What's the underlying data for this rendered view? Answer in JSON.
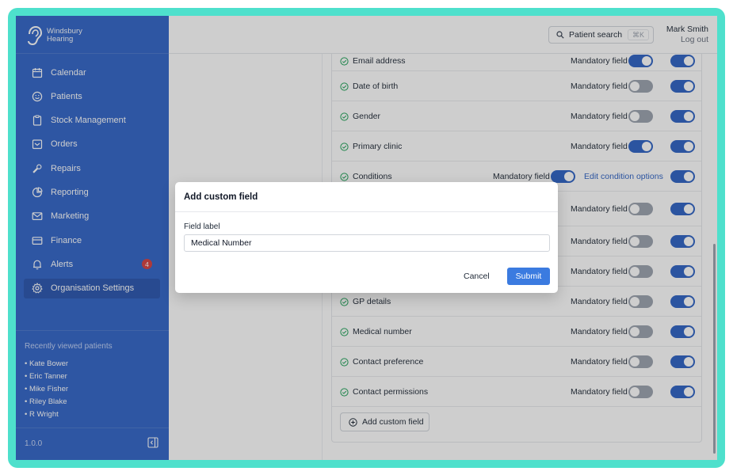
{
  "brand": {
    "line1": "Windsbury",
    "line2": "Hearing"
  },
  "nav": [
    {
      "label": "Calendar",
      "icon": "calendar-icon"
    },
    {
      "label": "Patients",
      "icon": "smiley-icon"
    },
    {
      "label": "Stock Management",
      "icon": "clipboard-icon"
    },
    {
      "label": "Orders",
      "icon": "inbox-icon"
    },
    {
      "label": "Repairs",
      "icon": "wrench-icon"
    },
    {
      "label": "Reporting",
      "icon": "pie-chart-icon"
    },
    {
      "label": "Marketing",
      "icon": "mail-icon"
    },
    {
      "label": "Finance",
      "icon": "credit-card-icon"
    },
    {
      "label": "Alerts",
      "icon": "bell-icon",
      "badge": "4"
    },
    {
      "label": "Organisation Settings",
      "icon": "gear-icon",
      "active": true
    }
  ],
  "recent": {
    "title": "Recently viewed patients",
    "items": [
      "• Kate Bower",
      "• Eric Tanner",
      "• Mike Fisher",
      "• Riley Blake",
      "• R Wright"
    ]
  },
  "version": "1.0.0",
  "topbar": {
    "search_label": "Patient search",
    "shortcut": "⌘K",
    "user_name": "Mark Smith",
    "logout": "Log out"
  },
  "fields": [
    {
      "label": "Email address",
      "mandatory": "Mandatory field",
      "mandatory_on": true,
      "enabled": true
    },
    {
      "label": "Date of birth",
      "mandatory": "Mandatory field",
      "mandatory_on": false,
      "enabled": true
    },
    {
      "label": "Gender",
      "mandatory": "Mandatory field",
      "mandatory_on": false,
      "enabled": true
    },
    {
      "label": "Primary clinic",
      "mandatory": "Mandatory field",
      "mandatory_on": true,
      "enabled": true
    },
    {
      "label": "Conditions",
      "mandatory": "Mandatory field",
      "mandatory_on": true,
      "enabled": true,
      "edit": "Edit condition options"
    },
    {
      "label": "",
      "mandatory": "Mandatory field",
      "mandatory_on": false,
      "enabled": true
    },
    {
      "label": "",
      "mandatory": "Mandatory field",
      "mandatory_on": false,
      "enabled": true
    },
    {
      "label": "",
      "mandatory": "Mandatory field",
      "mandatory_on": false,
      "enabled": true
    },
    {
      "label": "GP details",
      "mandatory": "Mandatory field",
      "mandatory_on": false,
      "enabled": true
    },
    {
      "label": "Medical number",
      "mandatory": "Mandatory field",
      "mandatory_on": false,
      "enabled": true
    },
    {
      "label": "Contact preference",
      "mandatory": "Mandatory field",
      "mandatory_on": false,
      "enabled": true
    },
    {
      "label": "Contact permissions",
      "mandatory": "Mandatory field",
      "mandatory_on": false,
      "enabled": true
    }
  ],
  "add_field_label": "Add custom field",
  "modal": {
    "title": "Add custom field",
    "field_label": "Field label",
    "field_value": "Medical Number",
    "cancel": "Cancel",
    "submit": "Submit"
  },
  "colors": {
    "sidebar": "#3366c8",
    "accent": "#2f63c4",
    "frame": "#4ee0cc",
    "badge": "#d64040"
  }
}
